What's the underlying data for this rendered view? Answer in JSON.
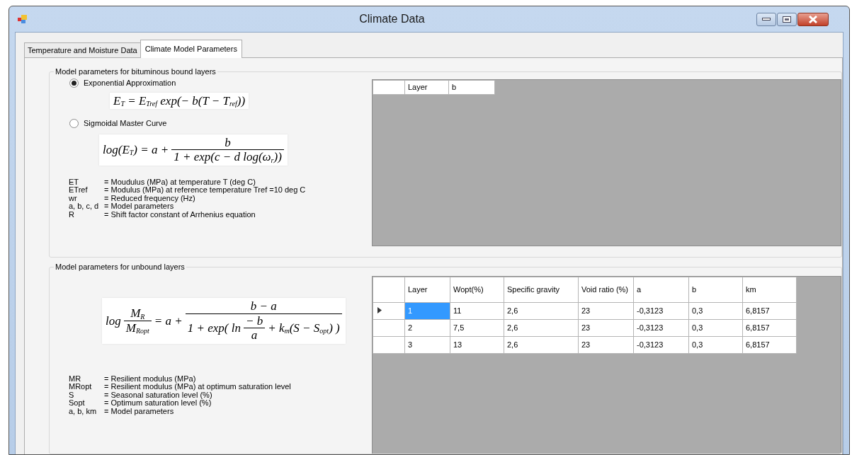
{
  "window": {
    "title": "Climate Data"
  },
  "tabs": [
    {
      "label": "Temperature and Moisture Data",
      "selected": false
    },
    {
      "label": "Climate Model Parameters",
      "selected": true
    }
  ],
  "bound_group": {
    "title": "Model parameters for bituminous bound layers",
    "options": [
      {
        "label": "Exponential Approximation",
        "selected": true,
        "formula": [
          {
            "kind": "text",
            "text": "E$_{T}$ = E$_{Tref}$ exp(− b(T − T$_{ref}$))"
          }
        ]
      },
      {
        "label": "Sigmoidal Master Curve",
        "selected": false,
        "formula": [
          {
            "kind": "text",
            "text": "log(E$_{T}$) = a +"
          },
          {
            "kind": "frac",
            "num": [
              {
                "kind": "text",
                "text": "b"
              }
            ],
            "den": [
              {
                "kind": "text",
                "text": "1 + exp(c − d log(ω$_{r}$))"
              }
            ]
          }
        ]
      }
    ],
    "legend": [
      {
        "term": "ET",
        "definition": "= Moudulus (MPa) at temperature T (deg C)"
      },
      {
        "term": "ETref",
        "definition": "= Modulus (MPa) at reference temperature Tref =10 deg C"
      },
      {
        "term": "wr",
        "definition": "= Reduced frequency (Hz)"
      },
      {
        "term": "a, b, c, d",
        "definition": "= Model parameters"
      },
      {
        "term": "R",
        "definition": "= Shift factor constant of Arrhenius equation"
      }
    ],
    "grid": {
      "columns": [
        "Layer",
        "b"
      ]
    }
  },
  "unbound_group": {
    "title": "Model parameters for unbound layers",
    "formula": [
      {
        "kind": "text",
        "text": "log"
      },
      {
        "kind": "frac",
        "num": [
          {
            "kind": "text",
            "text": "M$_{R}$"
          }
        ],
        "den": [
          {
            "kind": "text",
            "text": "M$_{Ropt}$"
          }
        ]
      },
      {
        "kind": "text",
        "text": "= a +"
      },
      {
        "kind": "frac",
        "num": [
          {
            "kind": "text",
            "text": "b − a"
          }
        ],
        "den": [
          {
            "kind": "text",
            "text": "1 + exp( ln"
          },
          {
            "kind": "frac",
            "num": [
              {
                "kind": "text",
                "text": "− b"
              }
            ],
            "den": [
              {
                "kind": "text",
                "text": "a"
              }
            ]
          },
          {
            "kind": "text",
            "text": "+ k$_{m}$(S − S$_{opt}$) )"
          }
        ]
      }
    ],
    "legend": [
      {
        "term": "MR",
        "definition": "= Resilient modulus (MPa)"
      },
      {
        "term": "MRopt",
        "definition": "= Resilient modulus (MPa) at optimum saturation level"
      },
      {
        "term": "S",
        "definition": "= Seasonal saturation level (%)"
      },
      {
        "term": "Sopt",
        "definition": "= Optimum saturation level (%)"
      },
      {
        "term": "a, b, km",
        "definition": "= Model parameters"
      }
    ],
    "grid": {
      "columns": [
        "Layer",
        "Wopt(%)",
        "Specific gravity",
        "Void ratio (%)",
        "a",
        "b",
        "km"
      ],
      "rows": [
        {
          "current": true,
          "cells": [
            {
              "text": "1",
              "selected": true
            },
            {
              "text": "11",
              "selected": false
            },
            {
              "text": "2,6",
              "selected": false
            },
            {
              "text": "23",
              "selected": false
            },
            {
              "text": "-0,3123",
              "selected": false
            },
            {
              "text": "0,3",
              "selected": false
            },
            {
              "text": "6,8157",
              "selected": false
            }
          ]
        },
        {
          "current": false,
          "cells": [
            {
              "text": "2",
              "selected": false
            },
            {
              "text": "7,5",
              "selected": false
            },
            {
              "text": "2,6",
              "selected": false
            },
            {
              "text": "23",
              "selected": false
            },
            {
              "text": "-0,3123",
              "selected": false
            },
            {
              "text": "0,3",
              "selected": false
            },
            {
              "text": "6,8157",
              "selected": false
            }
          ]
        },
        {
          "current": false,
          "cells": [
            {
              "text": "3",
              "selected": false
            },
            {
              "text": "13",
              "selected": false
            },
            {
              "text": "2,6",
              "selected": false
            },
            {
              "text": "23",
              "selected": false
            },
            {
              "text": "-0,3123",
              "selected": false
            },
            {
              "text": "0,3",
              "selected": false
            },
            {
              "text": "6,8157",
              "selected": false
            }
          ]
        }
      ]
    }
  }
}
